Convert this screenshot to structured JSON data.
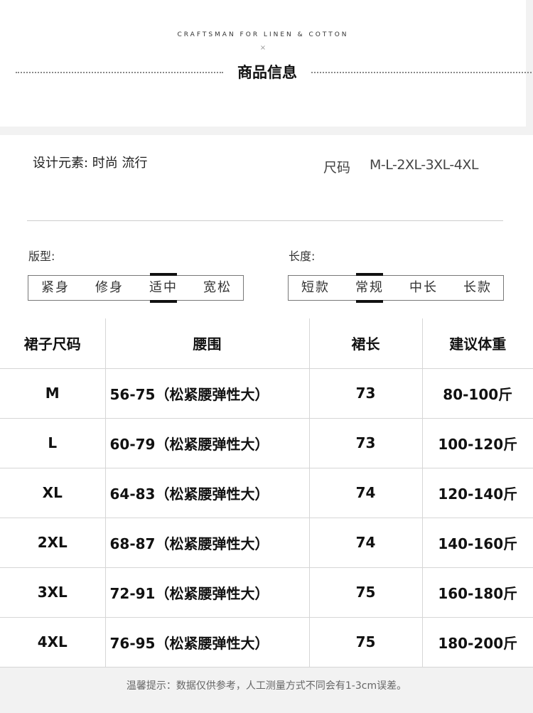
{
  "header": {
    "brand": "CRAFTSMAN FOR LINEN & COTTON",
    "separator": "×",
    "title": "商品信息"
  },
  "info": {
    "design_text": "设计元素: 时尚 流行",
    "size_label": "尺码",
    "size_value": "M-L-2XL-3XL-4XL",
    "fit": {
      "label": "版型:",
      "options": [
        "紧身",
        "修身",
        "适中",
        "宽松"
      ],
      "selected": 2
    },
    "length": {
      "label": "长度:",
      "options": [
        "短款",
        "常规",
        "中长",
        "长款"
      ],
      "selected": 1
    }
  },
  "table": {
    "headers": [
      "裙子尺码",
      "腰围",
      "裙长",
      "建议体重"
    ],
    "rows": [
      [
        "M",
        "56-75（松紧腰弹性大）",
        "73",
        "80-100斤"
      ],
      [
        "L",
        "60-79（松紧腰弹性大）",
        "73",
        "100-120斤"
      ],
      [
        "XL",
        "64-83（松紧腰弹性大）",
        "74",
        "120-140斤"
      ],
      [
        "2XL",
        "68-87（松紧腰弹性大）",
        "74",
        "140-160斤"
      ],
      [
        "3XL",
        "72-91（松紧腰弹性大）",
        "75",
        "160-180斤"
      ],
      [
        "4XL",
        "76-95（松紧腰弹性大）",
        "75",
        "180-200斤"
      ]
    ]
  },
  "note": "温馨提示：数据仅供参考，人工测量方式不同会有1-3cm误差。"
}
